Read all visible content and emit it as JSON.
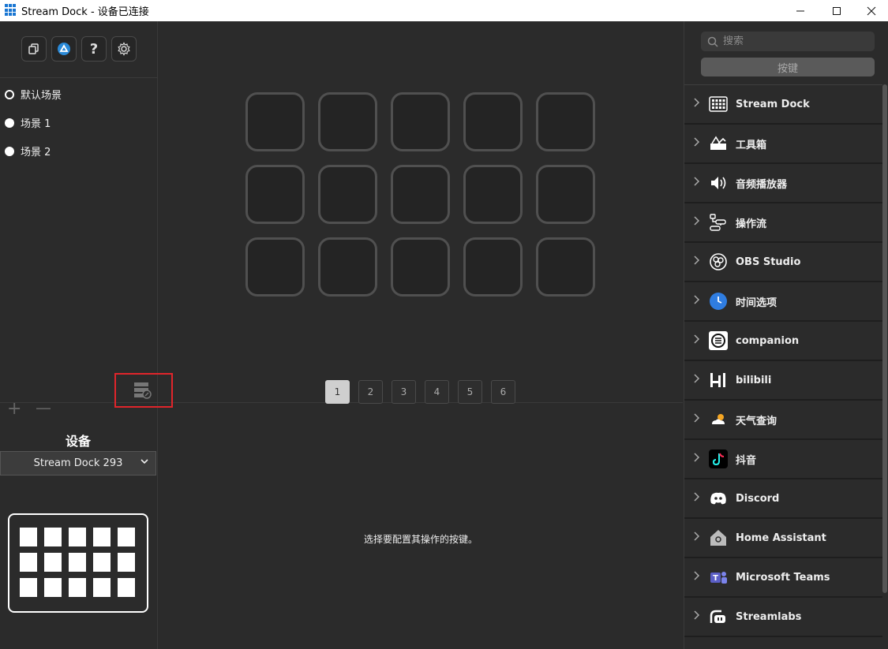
{
  "window": {
    "title": "Stream Dock - 设备已连接",
    "minimize": "—",
    "maximize": "☐",
    "close": "✕"
  },
  "toolbar": {
    "items": [
      {
        "icon": "copy-icon"
      },
      {
        "icon": "store-icon"
      },
      {
        "icon": "help-icon",
        "glyph": "?"
      },
      {
        "icon": "gear-icon"
      }
    ]
  },
  "scenes": [
    {
      "label": "默认场景",
      "active": true
    },
    {
      "label": "场景 1",
      "active": false
    },
    {
      "label": "场景 2",
      "active": false
    }
  ],
  "scene_actions": {
    "add": "+",
    "remove": "—"
  },
  "device": {
    "label": "设备",
    "selected": "Stream Dock 293"
  },
  "key_grid": {
    "rows": 3,
    "cols": 5
  },
  "pages": [
    "1",
    "2",
    "3",
    "4",
    "5",
    "6"
  ],
  "active_page": "1",
  "hint": "选择要配置其操作的按键。",
  "search": {
    "placeholder": "搜索"
  },
  "key_button": "按键",
  "plugins": [
    {
      "label": "Stream Dock",
      "icon": "stream-dock-icon"
    },
    {
      "label": "工具箱",
      "icon": "toolbox-icon"
    },
    {
      "label": "音频播放器",
      "icon": "audio-player-icon"
    },
    {
      "label": "操作流",
      "icon": "workflow-icon"
    },
    {
      "label": "OBS Studio",
      "icon": "obs-icon"
    },
    {
      "label": "时间选项",
      "icon": "clock-icon"
    },
    {
      "label": "companion",
      "icon": "companion-icon"
    },
    {
      "label": "bilibili",
      "icon": "bilibili-icon"
    },
    {
      "label": "天气查询",
      "icon": "weather-icon"
    },
    {
      "label": "抖音",
      "icon": "douyin-icon"
    },
    {
      "label": "Discord",
      "icon": "discord-icon"
    },
    {
      "label": "Home Assistant",
      "icon": "home-assistant-icon"
    },
    {
      "label": "Microsoft Teams",
      "icon": "teams-icon"
    },
    {
      "label": "Streamlabs",
      "icon": "streamlabs-icon"
    }
  ],
  "colors": {
    "accent": "#1976d2",
    "highlight": "#e0252b",
    "background": "#2b2b2b"
  }
}
